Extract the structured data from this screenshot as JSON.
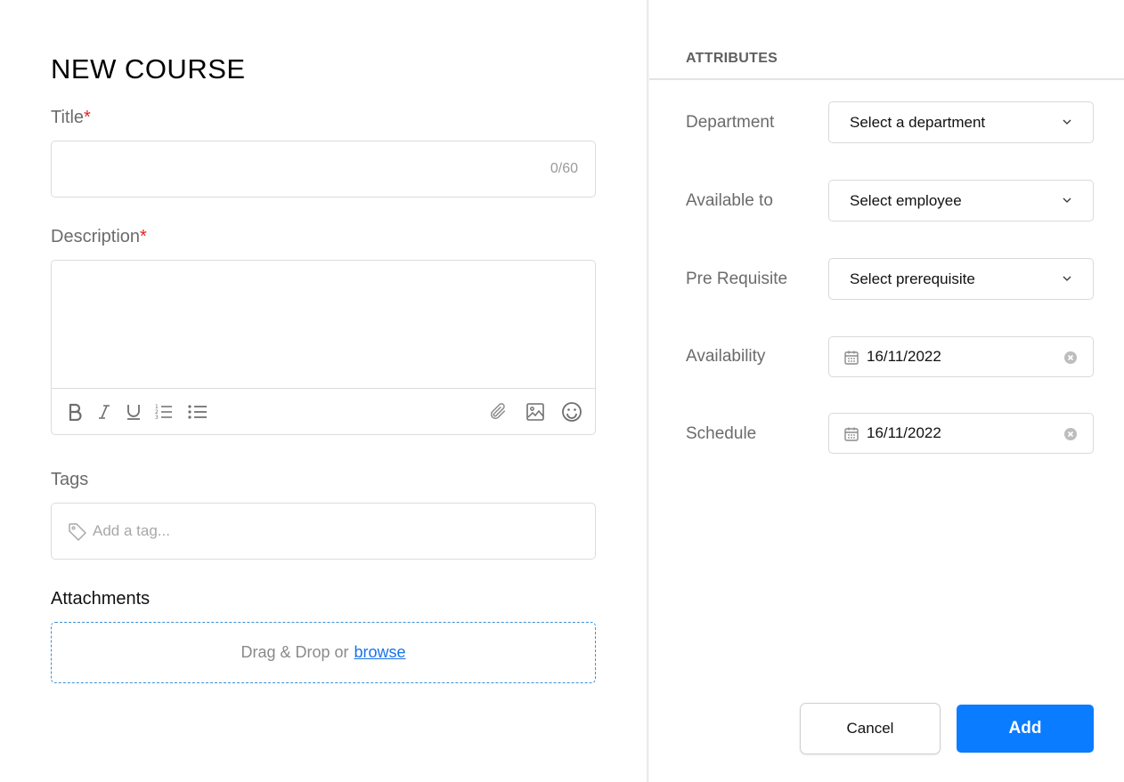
{
  "form": {
    "title": "NEW COURSE",
    "title_field": {
      "label": "Title",
      "required_mark": "*",
      "value": "",
      "char_count": "0/60"
    },
    "description_field": {
      "label": "Description",
      "required_mark": "*",
      "value": ""
    },
    "toolbar": {
      "left_icons": [
        "bold-icon",
        "italic-icon",
        "underline-icon",
        "ordered-list-icon",
        "bullet-list-icon"
      ],
      "right_icons": [
        "attachment-icon",
        "image-icon",
        "emoji-icon"
      ]
    },
    "tags_field": {
      "label": "Tags",
      "placeholder": "Add a tag..."
    },
    "attachments": {
      "label": "Attachments",
      "drop_text": "Drag & Drop or",
      "browse_link": "browse"
    }
  },
  "attributes": {
    "header": "ATTRIBUTES",
    "department": {
      "label": "Department",
      "value": "Select a department"
    },
    "available_to": {
      "label": "Available to",
      "value": "Select employee"
    },
    "prerequisite": {
      "label": "Pre Requisite",
      "value": "Select prerequisite"
    },
    "availability": {
      "label": "Availability",
      "value": "16/11/2022"
    },
    "schedule": {
      "label": "Schedule",
      "value": "16/11/2022"
    }
  },
  "actions": {
    "cancel_label": "Cancel",
    "add_label": "Add"
  },
  "colors": {
    "accent": "#0a7cff",
    "required": "#e02424",
    "link": "#1a73e8"
  }
}
